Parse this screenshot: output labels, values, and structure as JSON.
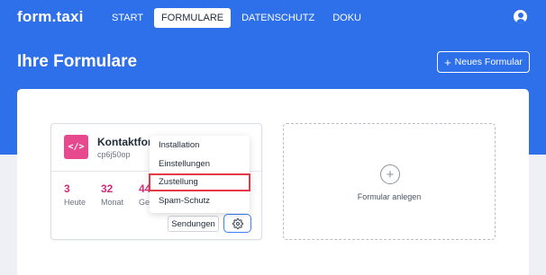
{
  "header": {
    "logo": "form.taxi",
    "nav": [
      {
        "label": "START",
        "active": false
      },
      {
        "label": "FORMULARE",
        "active": true
      },
      {
        "label": "DATENSCHUTZ",
        "active": false
      },
      {
        "label": "DOKU",
        "active": false
      }
    ],
    "user_icon": "user-circle-icon"
  },
  "page": {
    "title": "Ihre Formulare",
    "new_form_icon": "plus-icon",
    "new_form_label": "Neues Formular"
  },
  "form_card": {
    "icon": "code-icon",
    "icon_glyph": "</>",
    "icon_color": "#e6498e",
    "name": "Kontaktform",
    "id": "cp6j50op",
    "stats": [
      {
        "value": "3",
        "label": "Heute"
      },
      {
        "value": "32",
        "label": "Monat"
      },
      {
        "value": "44",
        "label": "Ges"
      }
    ],
    "sendungen_label": "Sendungen",
    "settings_icon": "gear-icon"
  },
  "dropdown": {
    "items": [
      "Installation",
      "Einstellungen",
      "Zustellung",
      "Spam-Schutz"
    ],
    "highlighted": "Zustellung"
  },
  "add_card": {
    "icon": "plus-circle-icon",
    "icon_glyph": "+",
    "label": "Formular anlegen"
  },
  "colors": {
    "primary": "#2e6fea",
    "accent": "#e6498e",
    "stat_value": "#d12d79",
    "highlight_border": "#e53945"
  }
}
